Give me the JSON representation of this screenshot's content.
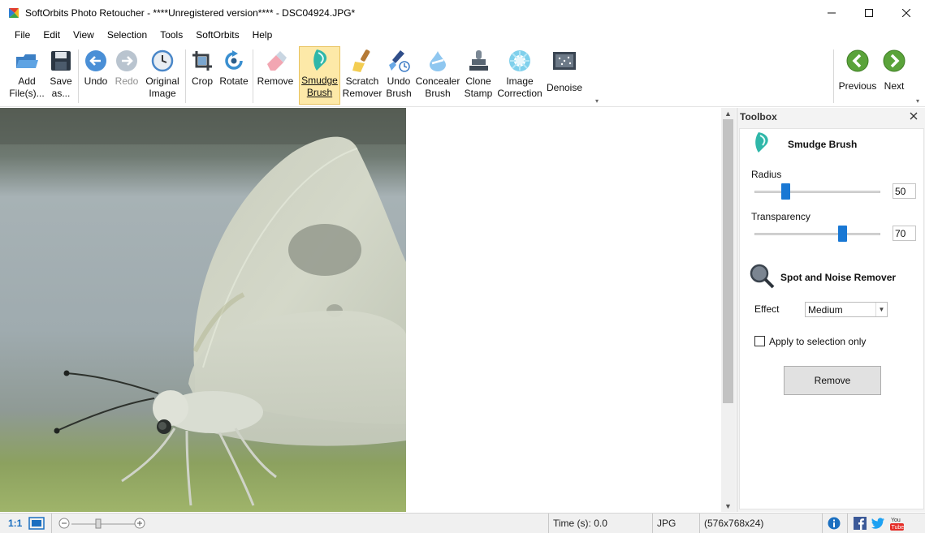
{
  "window": {
    "title": "SoftOrbits Photo Retoucher - ****Unregistered version**** - DSC04924.JPG*"
  },
  "menu": [
    "File",
    "Edit",
    "View",
    "Selection",
    "Tools",
    "SoftOrbits",
    "Help"
  ],
  "toolbar": {
    "add_files": "Add\nFile(s)...",
    "save_as": "Save\nas...",
    "undo": "Undo",
    "redo": "Redo",
    "original_image": "Original\nImage",
    "crop": "Crop",
    "rotate": "Rotate",
    "remove": "Remove",
    "smudge_brush": "Smudge\nBrush",
    "scratch_remover": "Scratch\nRemover",
    "undo_brush": "Undo\nBrush",
    "concealer_brush": "Concealer\nBrush",
    "clone_stamp": "Clone\nStamp",
    "image_correction": "Image\nCorrection",
    "denoise": "Denoise",
    "previous": "Previous",
    "next": "Next"
  },
  "toolbox": {
    "header": "Toolbox",
    "smudge_title": "Smudge Brush",
    "radius_label": "Radius",
    "radius_value": "50",
    "radius_fraction": 0.25,
    "transparency_label": "Transparency",
    "transparency_value": "70",
    "transparency_fraction": 0.7,
    "spot_title": "Spot and Noise Remover",
    "effect_label": "Effect",
    "effect_value": "Medium",
    "apply_selection_label": "Apply to selection only",
    "apply_selection_checked": false,
    "remove_button": "Remove"
  },
  "status": {
    "zoom_actual": "1:1",
    "time": "Time (s): 0.0",
    "format": "JPG",
    "dimensions": "(576x768x24)"
  },
  "colors": {
    "accent_blue": "#1978d4",
    "active_tool_bg": "#fde9a8",
    "nav_green": "#5aa33a"
  }
}
